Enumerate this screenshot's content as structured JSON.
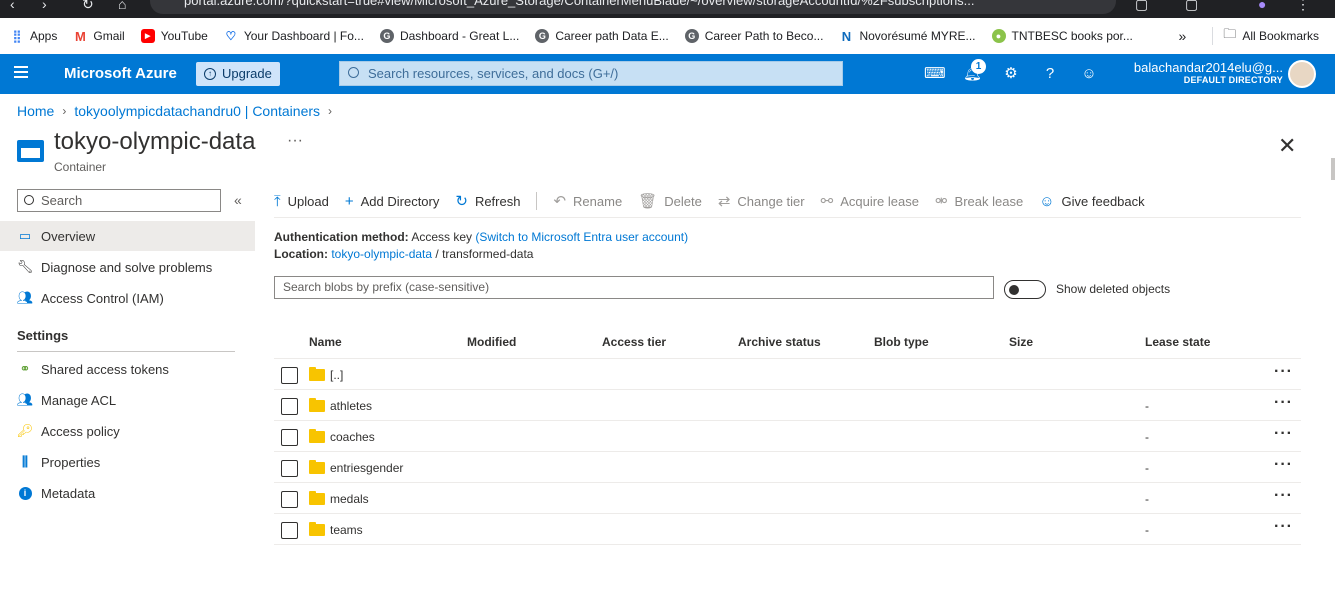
{
  "browser": {
    "url": "portal.azure.com/?quickstart=true#view/Microsoft_Azure_Storage/ContainerMenuBlade/~/overview/storageAccountId/%2Fsubscriptions...",
    "bookmarks": [
      {
        "label": "Apps",
        "icon": "apps-grid-icon",
        "color": "#4285f4"
      },
      {
        "label": "Gmail",
        "icon": "gmail-icon",
        "color": "#ea4335"
      },
      {
        "label": "YouTube",
        "icon": "youtube-icon",
        "color": "#ff0000"
      },
      {
        "label": "Your Dashboard | Fo...",
        "icon": "dashboard-icon",
        "color": "#1a73e8"
      },
      {
        "label": "Dashboard - Great L...",
        "icon": "google-g-icon",
        "color": "#5f6368"
      },
      {
        "label": "Career path  Data E...",
        "icon": "google-g-icon",
        "color": "#5f6368"
      },
      {
        "label": "Career Path to Beco...",
        "icon": "google-g-icon",
        "color": "#5f6368"
      },
      {
        "label": "Novorésumé MYRE...",
        "icon": "novoresume-icon",
        "color": "#0f2d52"
      },
      {
        "label": "TNTBESC books por...",
        "icon": "tntbesc-icon",
        "color": "#34a853"
      }
    ],
    "all_bookmarks": "All Bookmarks"
  },
  "header": {
    "brand": "Microsoft Azure",
    "upgrade": "Upgrade",
    "search_placeholder": "Search resources, services, and docs (G+/)",
    "notification_count": "1",
    "user_email": "balachandar2014elu@g...",
    "directory": "DEFAULT DIRECTORY",
    "accent": "#0078d4"
  },
  "breadcrumb": {
    "home": "Home",
    "account": "tokyoolympicdatachandru0 | Containers"
  },
  "page": {
    "title": "tokyo-olympic-data",
    "subtitle": "Container",
    "more": "···",
    "close": "✕"
  },
  "nav": {
    "search_placeholder": "Search",
    "collapse": "«",
    "items": [
      {
        "label": "Overview",
        "icon": "overview-icon"
      },
      {
        "label": "Diagnose and solve problems",
        "icon": "wrench-icon"
      },
      {
        "label": "Access Control (IAM)",
        "icon": "people-icon"
      }
    ],
    "settings_header": "Settings",
    "settings_items": [
      {
        "label": "Shared access tokens",
        "icon": "link-icon"
      },
      {
        "label": "Manage ACL",
        "icon": "people-icon"
      },
      {
        "label": "Access policy",
        "icon": "key-icon"
      },
      {
        "label": "Properties",
        "icon": "properties-icon"
      },
      {
        "label": "Metadata",
        "icon": "info-icon"
      }
    ]
  },
  "toolbar": {
    "upload": "Upload",
    "add_directory": "Add Directory",
    "refresh": "Refresh",
    "rename": "Rename",
    "delete": "Delete",
    "change_tier": "Change tier",
    "acquire_lease": "Acquire lease",
    "break_lease": "Break lease",
    "give_feedback": "Give feedback"
  },
  "info": {
    "auth_label": "Authentication method:",
    "auth_value": "Access key",
    "auth_link": "(Switch to Microsoft Entra user account)",
    "location_label": "Location:",
    "location_link": "tokyo-olympic-data",
    "location_sep": "/",
    "location_path": "transformed-data"
  },
  "blob_search": {
    "placeholder": "Search blobs by prefix (case-sensitive)",
    "show_deleted": "Show deleted objects"
  },
  "table": {
    "columns": [
      "Name",
      "Modified",
      "Access tier",
      "Archive status",
      "Blob type",
      "Size",
      "Lease state"
    ],
    "rows": [
      {
        "name": "[..]",
        "lease": ""
      },
      {
        "name": "athletes",
        "lease": "-"
      },
      {
        "name": "coaches",
        "lease": "-"
      },
      {
        "name": "entriesgender",
        "lease": "-"
      },
      {
        "name": "medals",
        "lease": "-"
      },
      {
        "name": "teams",
        "lease": "-"
      }
    ],
    "more": "···"
  }
}
